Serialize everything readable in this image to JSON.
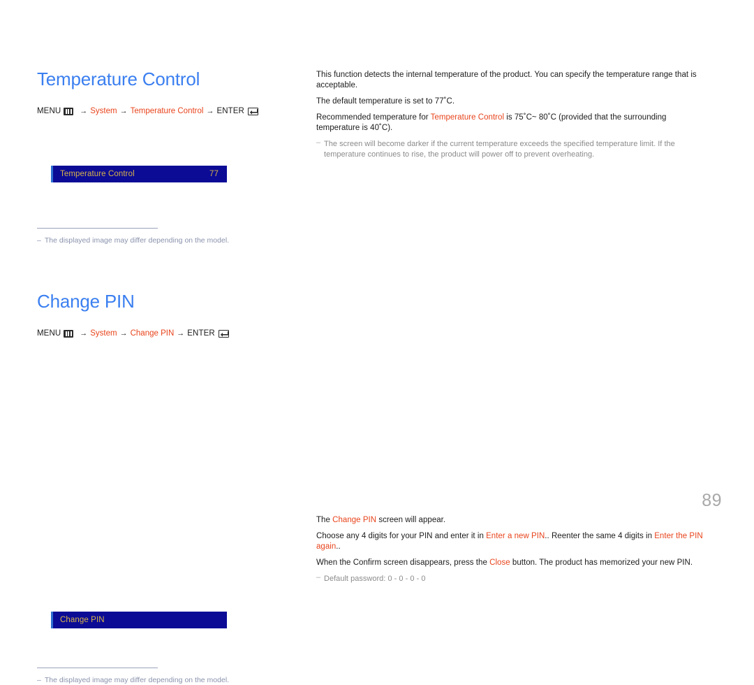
{
  "document": {
    "page_number": "89"
  },
  "colors": {
    "heading_blue": "#3b7ff0",
    "link_orange": "#e8441c",
    "osd_background": "#0b0b96",
    "osd_text_gold": "#d8b24a",
    "osd_edge_blue": "#2f6fd0",
    "note_grey": "#8b8b8b",
    "footnote_blue_grey": "#8a93ad",
    "page_number_grey": "#a8a8a8"
  },
  "sections": [
    {
      "id": "temperature",
      "title": "Temperature Control",
      "menu_path": {
        "menu_label": "MENU",
        "menu_icon": "menu-grid-icon",
        "arrow": "→",
        "step1": "System",
        "step2": "Temperature Control",
        "enter_label": "ENTER",
        "enter_icon": "enter-return-icon"
      },
      "osd": {
        "label": "Temperature Control",
        "value": "77"
      },
      "footnote": {
        "dash": "–",
        "text": "The displayed image may differ depending on the model."
      },
      "body": {
        "p1_a": "This function detects the internal temperature of the product. You can specify the temperature range that is acceptable.",
        "p2_a": "The default temperature is set to 77˚C.",
        "p3_a": "Recommended temperature for ",
        "p3_link": "Temperature Control",
        "p3_b": " is 75˚C~ 80˚C (provided that the surrounding temperature is 40˚C).",
        "note_dash": "–",
        "note_text": "The screen will become darker if the current temperature exceeds the specified temperature limit. If the temperature continues to rise, the product will power off to prevent overheating."
      }
    },
    {
      "id": "changepin",
      "title": "Change PIN",
      "menu_path": {
        "menu_label": "MENU",
        "menu_icon": "menu-grid-icon",
        "arrow": "→",
        "step1": "System",
        "step2": "Change PIN",
        "enter_label": "ENTER",
        "enter_icon": "enter-return-icon"
      },
      "osd": {
        "label": "Change PIN",
        "value": ""
      },
      "footnote": {
        "dash": "–",
        "text": "The displayed image may differ depending on the model."
      },
      "body": {
        "p1_a": "The ",
        "p1_link": "Change PIN",
        "p1_b": " screen will appear.",
        "p2_a": "Choose any 4 digits for your PIN and enter it in ",
        "p2_link1": "Enter a new PIN",
        "p2_b": ".. Reenter the same 4 digits in ",
        "p2_link2": "Enter the PIN again",
        "p2_c": "..",
        "p3_a": "When the Confirm screen disappears, press the ",
        "p3_link": "Close",
        "p3_b": " button. The product has memorized your new PIN.",
        "note_dash": "–",
        "note_text": "Default password: 0 - 0 - 0 - 0"
      }
    }
  ]
}
